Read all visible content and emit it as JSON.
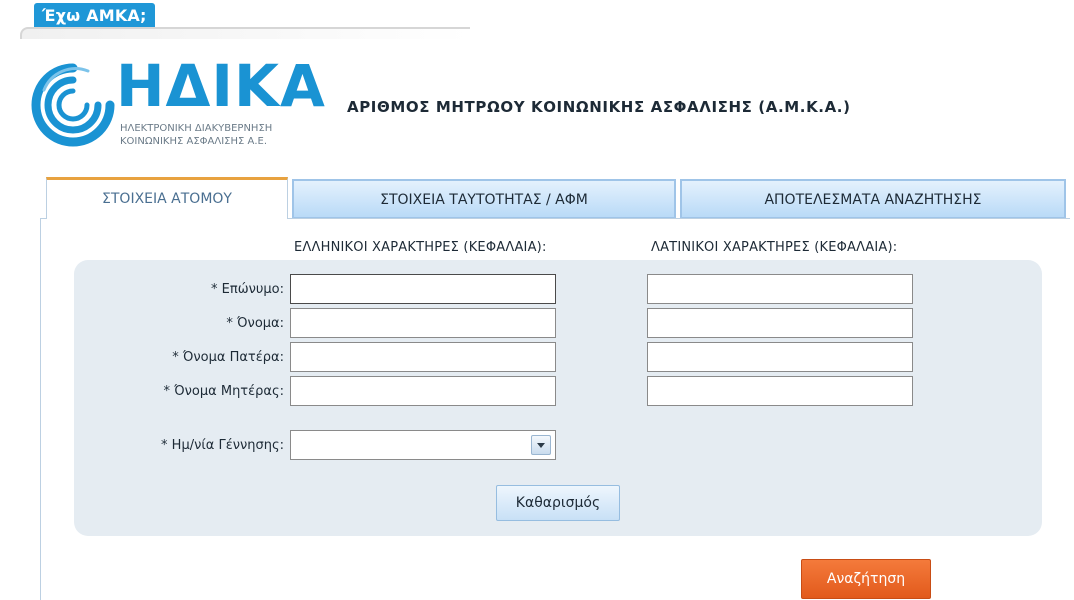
{
  "top_badge": "Έχω ΑΜΚΑ;",
  "logo": {
    "wordmark": "ΗΔΙΚΑ",
    "subtitle_line1": "ΗΛΕΚΤΡΟΝΙΚΗ ΔΙΑΚΥΒΕΡΝΗΣΗ",
    "subtitle_line2": "ΚΟΙΝΩΝΙΚΗΣ ΑΣΦΑΛΙΣΗΣ Α.Ε."
  },
  "app_title": "ΑΡΙΘΜΟΣ ΜΗΤΡΩΟΥ ΚΟΙΝΩΝΙΚΗΣ ΑΣΦΑΛΙΣΗΣ (Α.Μ.Κ.Α.)",
  "tabs": [
    {
      "label": "ΣΤΟΙΧΕΙΑ ΑΤΟΜΟΥ",
      "active": true
    },
    {
      "label": "ΣΤΟΙΧΕΙΑ ΤΑΥΤΟΤΗΤΑΣ / ΑΦΜ",
      "active": false
    },
    {
      "label": "ΑΠΟΤΕΛΕΣΜΑΤΑ ΑΝΑΖΗΤΗΣΗΣ",
      "active": false
    }
  ],
  "form": {
    "greek_header": "ΕΛΛΗΝΙΚΟΙ ΧΑΡΑΚΤΗΡΕΣ (ΚΕΦΑΛΑΙΑ):",
    "latin_header": "ΛΑΤΙΝΙΚΟΙ ΧΑΡΑΚΤΗΡΕΣ (ΚΕΦΑΛΑΙΑ):",
    "fields": [
      {
        "label": "* Επώνυμο:",
        "greek_value": "",
        "latin_value": ""
      },
      {
        "label": "* Όνομα:",
        "greek_value": "",
        "latin_value": ""
      },
      {
        "label": "* Όνομα Πατέρα:",
        "greek_value": "",
        "latin_value": ""
      },
      {
        "label": "* Όνομα Μητέρας:",
        "greek_value": "",
        "latin_value": ""
      }
    ],
    "birthdate_label": "* Ημ/νία Γέννησης:",
    "birthdate_value": "",
    "clear_label": "Καθαρισμός",
    "search_label": "Αναζήτηση"
  },
  "colors": {
    "brand_blue": "#1a93d3",
    "tab_accent": "#e8a23f",
    "search_orange": "#e25a1c"
  }
}
